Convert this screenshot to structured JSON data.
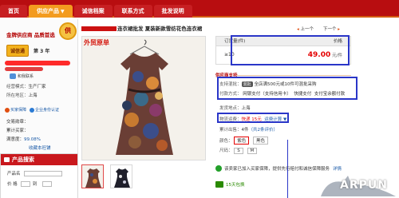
{
  "nav": {
    "items": [
      {
        "label": "首页",
        "active": false
      },
      {
        "label": "供应产品",
        "active": true,
        "icon": "chevron-down-icon"
      },
      {
        "label": "诚信档案",
        "active": false
      },
      {
        "label": "联系方式",
        "active": false
      },
      {
        "label": "批发说明",
        "active": false
      }
    ]
  },
  "sidebar": {
    "shop_title": "金牌供应商 品质首选",
    "seal_glyph": "供",
    "badge": "诚信通",
    "years": "第 3 年",
    "contact_label": "和我联系",
    "info": [
      {
        "key": "经营模式：",
        "value": "生产厂家"
      },
      {
        "key": "所在地区：",
        "value": "上海"
      }
    ],
    "links": [
      "买家保障",
      "企业身份认证"
    ],
    "stats": [
      {
        "key": "交易勋章：",
        "value": ""
      },
      {
        "key": "累计买家：",
        "value": ""
      },
      {
        "key": "满意度：",
        "value": "99.08%"
      }
    ],
    "collect_label": "收藏本旺铺",
    "search": {
      "title": "产品搜索",
      "fields": [
        {
          "label": "产品名",
          "value": ""
        },
        {
          "label": "价 格",
          "value": "",
          "to": "到"
        }
      ]
    }
  },
  "product": {
    "title": "连衣裙批发 夏装新款雪纺花色连衣裙",
    "image_label": "外贸原单"
  },
  "pager": {
    "prev": "上一个",
    "next": "下一个"
  },
  "price_table": {
    "head_qty": "订货量(件)",
    "head_price": "价格",
    "rows": [
      {
        "qty": "≥10",
        "price": "49.00",
        "unit": "元/件"
      }
    ]
  },
  "supplier": {
    "label": "供应商支持",
    "service_key": "支持混批：",
    "service_tag": "混批",
    "service_text": "全店满500元或10件可混批采购",
    "payment_key": "付款方式：",
    "payment_options": [
      "网银支付（支持信用卡）",
      "快捷支付",
      "支付宝余额付款"
    ],
    "ship_from_key": "发货地点：",
    "ship_from": "上海",
    "logistics_key": "物流运费：",
    "logistics_value": "快递 15元",
    "calc_label": "运费计算 ▼",
    "sold_key": "累计出售：",
    "sold_value": "4件",
    "records_label": "（共2条评价）",
    "color_key": "颜色：",
    "colors": [
      "紫色",
      "黑色"
    ],
    "size_key": "尺码：",
    "sizes": [
      "S",
      "M"
    ]
  },
  "notice": {
    "text": "该卖家已加入买家保障，提供先行赔付和诚信保障服务",
    "link": "详情"
  },
  "days": {
    "text": "15天包换"
  },
  "watermark": {
    "text": "ARPUN"
  }
}
